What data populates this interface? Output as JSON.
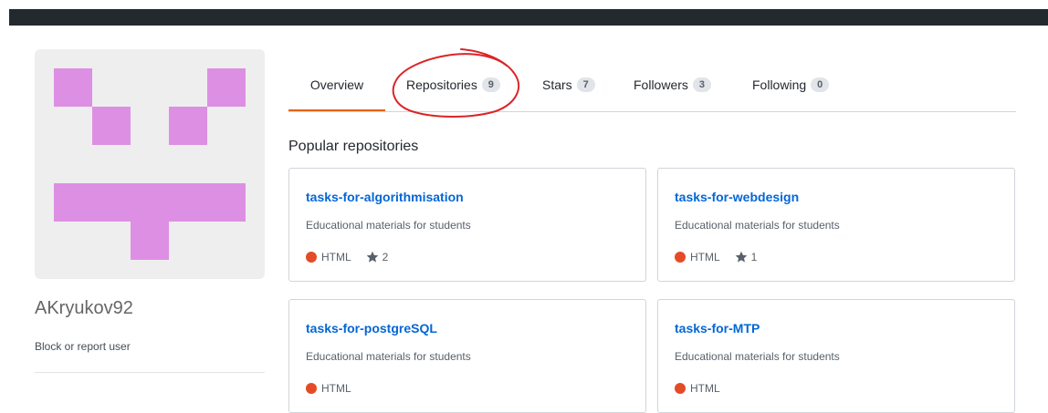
{
  "profile": {
    "username": "AKryukov92",
    "block_label": "Block or report user",
    "avatar_color": "#dd8fe3"
  },
  "tabs": [
    {
      "label": "Overview",
      "count": null,
      "selected": true
    },
    {
      "label": "Repositories",
      "count": "9",
      "selected": false
    },
    {
      "label": "Stars",
      "count": "7",
      "selected": false
    },
    {
      "label": "Followers",
      "count": "3",
      "selected": false
    },
    {
      "label": "Following",
      "count": "0",
      "selected": false
    }
  ],
  "popular": {
    "title": "Popular repositories",
    "repos": [
      {
        "name": "tasks-for-algorithmisation",
        "description": "Educational materials for students",
        "language": "HTML",
        "stars": "2"
      },
      {
        "name": "tasks-for-webdesign",
        "description": "Educational materials for students",
        "language": "HTML",
        "stars": "1"
      },
      {
        "name": "tasks-for-postgreSQL",
        "description": "Educational materials for students",
        "language": "HTML",
        "stars": null
      },
      {
        "name": "tasks-for-MTP",
        "description": "Educational materials for students",
        "language": "HTML",
        "stars": null
      }
    ]
  },
  "colors": {
    "accent_tab": "#e36209",
    "link": "#0366d6",
    "html_language": "#e34c26",
    "annotation": "#d9262a",
    "topbar": "#24292e"
  },
  "icons": {
    "star": "star-icon"
  }
}
